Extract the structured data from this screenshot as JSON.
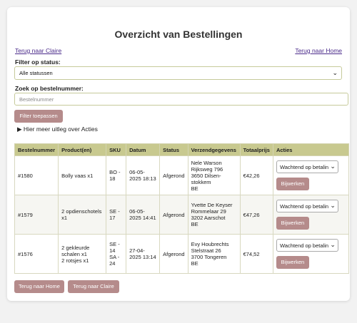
{
  "header": {
    "title": "Overzicht van Bestellingen",
    "back_claire_link": "Terug naar Claire",
    "back_home_link": "Terug naar Home"
  },
  "filters": {
    "status_label": "Filter op status:",
    "status_selected": "Alle statussen",
    "search_label": "Zoek op bestelnummer:",
    "search_placeholder": "Bestelnummer",
    "search_value": "",
    "apply_button": "Filter toepassen",
    "help_summary": "Hier meer uitleg over Acties"
  },
  "table": {
    "columns": [
      "Bestelnummer",
      "Product(en)",
      "SKU",
      "Datum",
      "Status",
      "Verzendgegevens",
      "Totaalprijs",
      "Acties"
    ],
    "rows": [
      {
        "order": "#1580",
        "products": "Bolly vaas x1",
        "sku": "BO - 18",
        "date": "06-05-2025 18:13",
        "status": "Afgerond",
        "shipping": [
          "Nele Warson",
          "Rijksweg 796",
          "3650 Dilsen-stokkem",
          "BE"
        ],
        "total": "€42,26",
        "action_status": "Wachtend op betalin",
        "update_label": "Bijwerken"
      },
      {
        "order": "#1579",
        "products": "2 opdienschotels x1",
        "sku": "SE - 17",
        "date": "06-05-2025 14:41",
        "status": "Afgerond",
        "shipping": [
          "Yvette De Keyser",
          "Rommelaar 29",
          "3202 Aarschot",
          "BE"
        ],
        "total": "€47,26",
        "action_status": "Wachtend op betalin",
        "update_label": "Bijwerken"
      },
      {
        "order": "#1576",
        "products": "2 gekleurde schalen x1\n2 rotsjes x1",
        "sku": "SE - 14\nSA - 24",
        "date": "27-04-2025 13:14",
        "status": "Afgerond",
        "shipping": [
          "Evy Houbrechts",
          "Stelstraat 26",
          "3700 Tongeren",
          "BE"
        ],
        "total": "€74,52",
        "action_status": "Wachtend op betalin",
        "update_label": "Bijwerken"
      }
    ]
  },
  "footer": {
    "home_button": "Terug naar Home",
    "claire_button": "Terug naar Claire"
  },
  "colors": {
    "button": "#b58b8b",
    "table_header": "#c8c98f",
    "link": "#4a2a8a"
  }
}
